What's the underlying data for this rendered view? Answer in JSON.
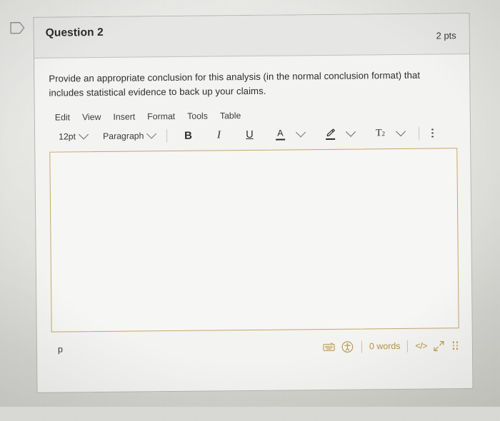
{
  "page": {
    "flag_icon": "flag-tag-icon",
    "background_color": "#dcdcd8"
  },
  "question": {
    "title": "Question 2",
    "points": "2 pts",
    "prompt": "Provide an appropriate conclusion for this analysis (in the normal conclusion format) that includes statistical evidence to back up your claims."
  },
  "editor": {
    "menubar": [
      {
        "label": "Edit"
      },
      {
        "label": "View"
      },
      {
        "label": "Insert"
      },
      {
        "label": "Format"
      },
      {
        "label": "Tools"
      },
      {
        "label": "Table"
      }
    ],
    "toolbar": {
      "font_size": "12pt",
      "block_format": "Paragraph",
      "bold": "B",
      "italic": "I",
      "underline": "U",
      "text_color": "A",
      "highlight": "✎",
      "superscript": "T",
      "superscript_exponent": "2",
      "more_label": "More"
    },
    "content": "",
    "border_color": "#c9a46b",
    "statusbar": {
      "element_path": "p",
      "word_count": "0 words",
      "source_code": "</>",
      "keyboard_icon": "keyboard-icon",
      "accessibility_icon": "accessibility-icon",
      "fullscreen_icon": "fullscreen-icon",
      "resize_grip": "resize-grip-icon",
      "accent_color": "#b59148"
    }
  }
}
